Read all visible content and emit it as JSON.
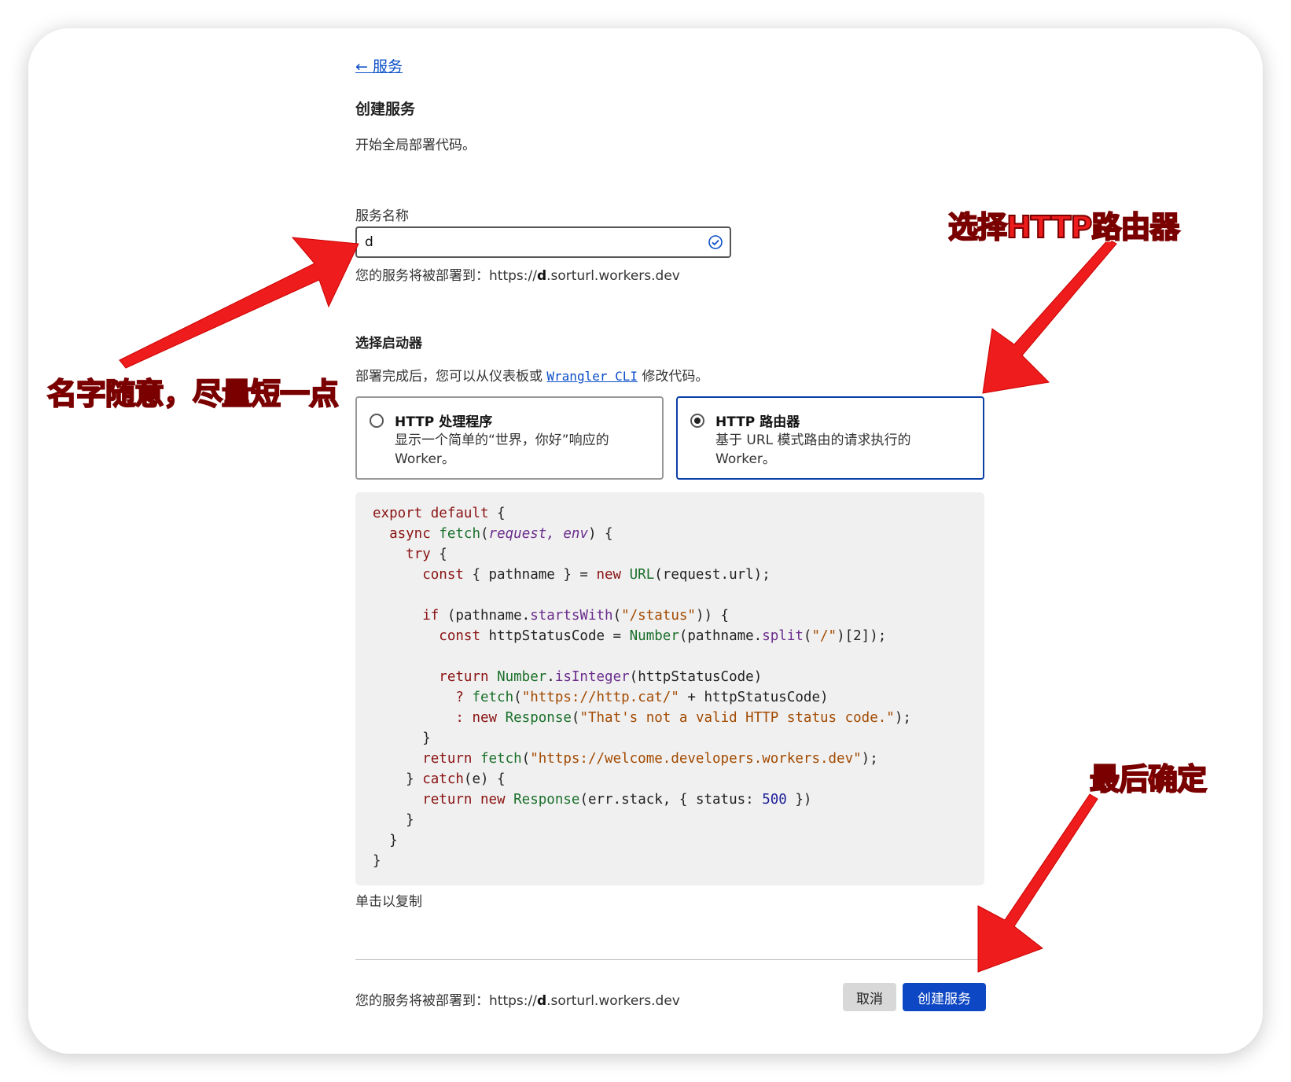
{
  "nav": {
    "back_icon": "←",
    "back_label": "服务"
  },
  "header": {
    "title": "创建服务",
    "subtitle": "开始全局部署代码。"
  },
  "service_name": {
    "label": "服务名称",
    "value": "d",
    "deploy_prefix": "您的服务将被部署到：https://",
    "deploy_name": "d",
    "deploy_suffix": ".sorturl.workers.dev"
  },
  "starter": {
    "title": "选择启动器",
    "desc_before": "部署完成后，您可以从仪表板或 ",
    "desc_link": "Wrangler CLI",
    "desc_after": " 修改代码。",
    "options": [
      {
        "title": "HTTP 处理程序",
        "desc": "显示一个简单的“世界，你好”响应的 Worker。",
        "selected": false
      },
      {
        "title": "HTTP 路由器",
        "desc": "基于 URL 模式路由的请求执行的 Worker。",
        "selected": true
      }
    ]
  },
  "code": {
    "lines": [
      [
        [
          "kw",
          "export default"
        ],
        [
          "p",
          " {"
        ]
      ],
      [
        [
          "p",
          "  "
        ],
        [
          "kw",
          "async"
        ],
        [
          "p",
          " "
        ],
        [
          "fn",
          "fetch"
        ],
        [
          "p",
          "("
        ],
        [
          "par",
          "request, env"
        ],
        [
          "p",
          ") {"
        ]
      ],
      [
        [
          "p",
          "    "
        ],
        [
          "kw",
          "try"
        ],
        [
          "p",
          " {"
        ]
      ],
      [
        [
          "p",
          "      "
        ],
        [
          "kw",
          "const"
        ],
        [
          "p",
          " { pathname } = "
        ],
        [
          "kw",
          "new"
        ],
        [
          "p",
          " "
        ],
        [
          "fn",
          "URL"
        ],
        [
          "p",
          "(request.url);"
        ]
      ],
      [
        [
          "p",
          ""
        ]
      ],
      [
        [
          "p",
          "      "
        ],
        [
          "kw",
          "if"
        ],
        [
          "p",
          " (pathname."
        ],
        [
          "par2",
          "startsWith"
        ],
        [
          "p",
          "("
        ],
        [
          "str",
          "\"/status\""
        ],
        [
          "p",
          ")) {"
        ]
      ],
      [
        [
          "p",
          "        "
        ],
        [
          "kw",
          "const"
        ],
        [
          "p",
          " httpStatusCode = "
        ],
        [
          "fn",
          "Number"
        ],
        [
          "p",
          "(pathname."
        ],
        [
          "par2",
          "split"
        ],
        [
          "p",
          "("
        ],
        [
          "str",
          "\"/\""
        ],
        [
          "p",
          ")[2]);"
        ]
      ],
      [
        [
          "p",
          ""
        ]
      ],
      [
        [
          "p",
          "        "
        ],
        [
          "kw",
          "return"
        ],
        [
          "p",
          " "
        ],
        [
          "fn",
          "Number"
        ],
        [
          "p",
          "."
        ],
        [
          "par2",
          "isInteger"
        ],
        [
          "p",
          "(httpStatusCode)"
        ]
      ],
      [
        [
          "p",
          "          "
        ],
        [
          "kw",
          "?"
        ],
        [
          "p",
          " "
        ],
        [
          "fn",
          "fetch"
        ],
        [
          "p",
          "("
        ],
        [
          "str",
          "\"https://http.cat/\""
        ],
        [
          "p",
          " + httpStatusCode)"
        ]
      ],
      [
        [
          "p",
          "          "
        ],
        [
          "kw",
          ":"
        ],
        [
          "p",
          " "
        ],
        [
          "kw",
          "new"
        ],
        [
          "p",
          " "
        ],
        [
          "fn",
          "Response"
        ],
        [
          "p",
          "("
        ],
        [
          "str",
          "\"That's not a valid HTTP status code.\""
        ],
        [
          "p",
          ");"
        ]
      ],
      [
        [
          "p",
          "      }"
        ]
      ],
      [
        [
          "p",
          "      "
        ],
        [
          "kw",
          "return"
        ],
        [
          "p",
          " "
        ],
        [
          "fn",
          "fetch"
        ],
        [
          "p",
          "("
        ],
        [
          "str",
          "\"https://welcome.developers.workers.dev\""
        ],
        [
          "p",
          ");"
        ]
      ],
      [
        [
          "p",
          "    } "
        ],
        [
          "kw",
          "catch"
        ],
        [
          "p",
          "(e) {"
        ]
      ],
      [
        [
          "p",
          "      "
        ],
        [
          "kw",
          "return"
        ],
        [
          "p",
          " "
        ],
        [
          "kw",
          "new"
        ],
        [
          "p",
          " "
        ],
        [
          "fn",
          "Response"
        ],
        [
          "p",
          "(err.stack, { status: "
        ],
        [
          "num",
          "500"
        ],
        [
          "p",
          " })"
        ]
      ],
      [
        [
          "p",
          "    }"
        ]
      ],
      [
        [
          "p",
          "  }"
        ]
      ],
      [
        [
          "p",
          "}"
        ]
      ]
    ],
    "copy_hint": "单击以复制"
  },
  "footer": {
    "deploy_prefix": "您的服务将被部署到：https://",
    "deploy_name": "d",
    "deploy_suffix": ".sorturl.workers.dev",
    "cancel_label": "取消",
    "create_label": "创建服务"
  },
  "annotations": {
    "name_tip": "名字随意，尽量短一点",
    "router_tip": "选择HTTP路由器",
    "confirm_tip": "最后确定"
  },
  "colors": {
    "accent": "#0d47c4",
    "link": "#0b4fc7",
    "annotation_red": "#ee1c1c",
    "code_bg": "#f0f0f0"
  }
}
